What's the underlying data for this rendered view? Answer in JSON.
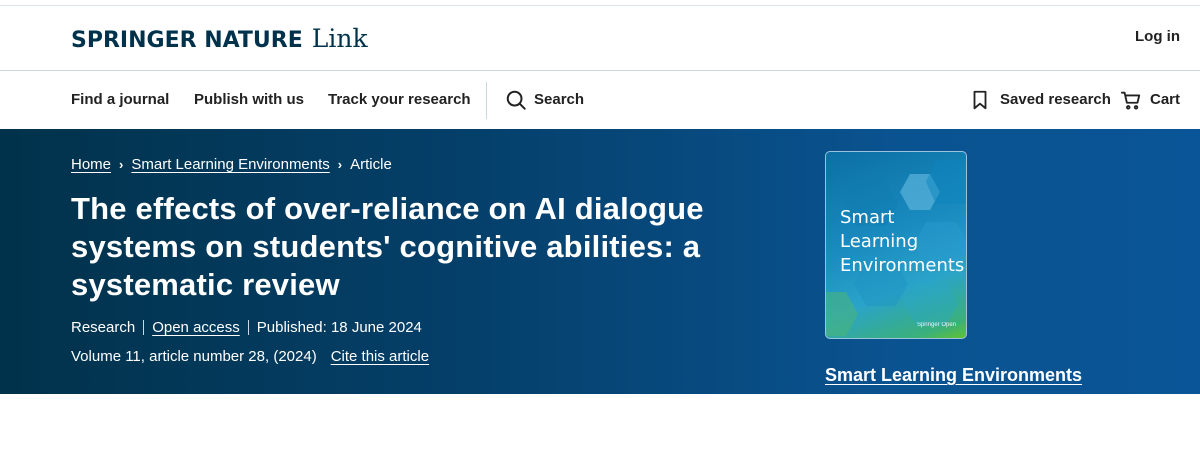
{
  "header": {
    "logo_main": "SPRINGER NATURE",
    "logo_sub": "Link",
    "login_label": "Log in"
  },
  "nav": {
    "find_journal": "Find a journal",
    "publish": "Publish with us",
    "track": "Track your research",
    "search": "Search",
    "saved": "Saved research",
    "cart": "Cart",
    "icons": [
      "search-icon",
      "bookmark-icon",
      "cart-icon"
    ]
  },
  "breadcrumb": {
    "home": "Home",
    "journal": "Smart Learning Environments",
    "current": "Article"
  },
  "article": {
    "title": "The effects of over-reliance on AI dialogue systems on students' cognitive abilities: a systematic review",
    "type": "Research",
    "access": "Open access",
    "published": "Published: 18 June 2024",
    "volume": "Volume 11, article number 28, (2024)",
    "cite_label": "Cite this article"
  },
  "journal_cover": {
    "title_line1": "Smart",
    "title_line2": "Learning",
    "title_line3": "Environments",
    "publisher": "Springer Open"
  },
  "journal_link": "Smart Learning Environments",
  "colors": {
    "brand_dark": "#01324b",
    "hero_start": "#01324b",
    "hero_end": "#0a5597",
    "text_white": "#ffffff"
  }
}
